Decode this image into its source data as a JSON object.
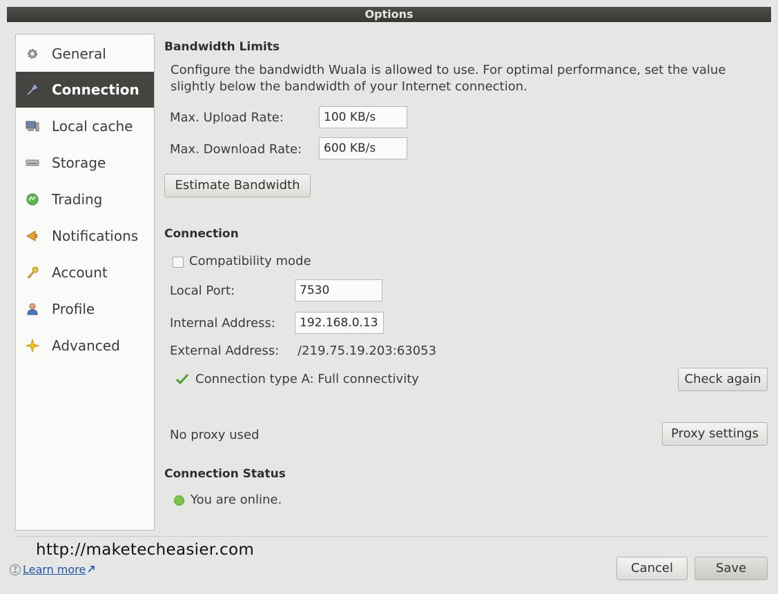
{
  "window": {
    "title": "Options"
  },
  "sidebar": {
    "items": [
      {
        "label": "General",
        "icon": "gear-icon"
      },
      {
        "label": "Connection",
        "icon": "plug-icon",
        "active": true
      },
      {
        "label": "Local cache",
        "icon": "computer-icon"
      },
      {
        "label": "Storage",
        "icon": "drive-icon"
      },
      {
        "label": "Trading",
        "icon": "globe-icon"
      },
      {
        "label": "Notifications",
        "icon": "megaphone-icon"
      },
      {
        "label": "Account",
        "icon": "key-icon"
      },
      {
        "label": "Profile",
        "icon": "person-icon"
      },
      {
        "label": "Advanced",
        "icon": "star-icon"
      }
    ]
  },
  "bandwidth": {
    "heading": "Bandwidth Limits",
    "description": "Configure the bandwidth Wuala is allowed to use. For optimal performance, set the value slightly below the bandwidth of your Internet connection.",
    "upload_label": "Max. Upload Rate:",
    "upload_value": "100 KB/s",
    "download_label": "Max. Download Rate:",
    "download_value": "600 KB/s",
    "estimate_button": "Estimate Bandwidth"
  },
  "connection": {
    "heading": "Connection",
    "compatibility_label": "Compatibility mode",
    "compatibility_checked": false,
    "local_port_label": "Local Port:",
    "local_port_value": "7530",
    "internal_address_label": "Internal Address:",
    "internal_address_value": "192.168.0.13",
    "external_address_label": "External Address:",
    "external_address_value": "/219.75.19.203:63053",
    "type_text": "Connection type A: Full connectivity",
    "check_again_button": "Check again",
    "proxy_text": "No proxy used",
    "proxy_button": "Proxy settings"
  },
  "status": {
    "heading": "Connection Status",
    "text": "You are online."
  },
  "footer": {
    "watermark": "http://maketecheasier.com",
    "learn_more": "Learn more",
    "cancel_button": "Cancel",
    "save_button": "Save"
  },
  "colors": {
    "title_bar": "#3f3e3b",
    "active_item": "#454441",
    "link": "#1c55b4",
    "online_dot": "#7cc44a",
    "check_mark": "#4aa02c"
  }
}
